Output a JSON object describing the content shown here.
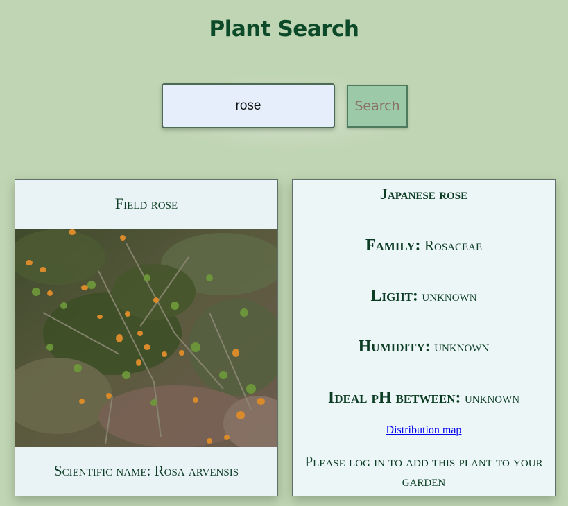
{
  "header": {
    "title": "Plant Search"
  },
  "search": {
    "value": "rose",
    "button_label": "Search"
  },
  "results": [
    {
      "common_name": "Field rose",
      "scientific_label": "Scientific name:",
      "scientific_name": "Rosa arvensis"
    },
    {
      "common_name": "Japanese rose",
      "family_label": "Family:",
      "family": "Rosaceae",
      "light_label": "Light:",
      "light": "unknown",
      "humidity_label": "Humidity:",
      "humidity": "unknown",
      "ph_label": "Ideal pH between:",
      "ph": "unknown",
      "distribution_link": "Distribution map",
      "login_message": "Please log in to add this plant to your garden"
    }
  ]
}
